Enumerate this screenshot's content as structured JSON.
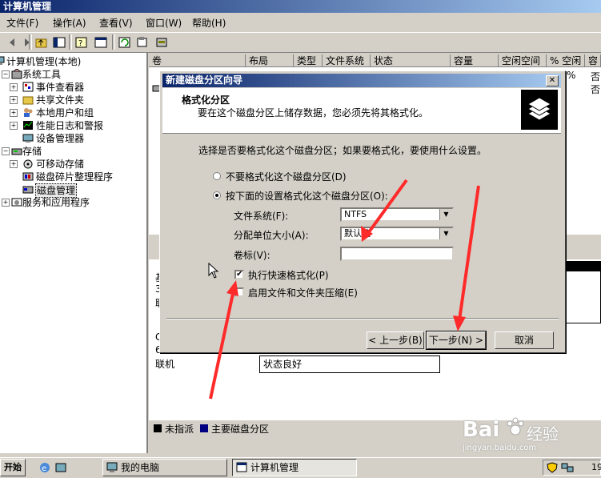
{
  "app": {
    "title": "计算机管理"
  },
  "menu": [
    "文件(F)",
    "操作(A)",
    "查看(V)",
    "窗口(W)",
    "帮助(H)"
  ],
  "tree": {
    "root": "计算机管理(本地)",
    "system_tools": "系统工具",
    "event_viewer": "事件查看器",
    "shared_folders": "共享文件夹",
    "local_users": "本地用户和组",
    "perf_logs": "性能日志和警报",
    "device_manager": "设备管理器",
    "storage": "存储",
    "removable": "可移动存储",
    "defrag": "磁盘碎片整理程序",
    "disk_mgmt": "磁盘管理",
    "services": "服务和应用程序"
  },
  "columns": [
    "卷",
    "布局",
    "类型",
    "文件系统",
    "状态",
    "容量",
    "空闲空间",
    "% 空闲",
    "容"
  ],
  "list_fragments": {
    "pct1": "%",
    "col1": "否",
    "col2": "否"
  },
  "disk": {
    "label_a": "基",
    "label_b": "30",
    "label_c": "联",
    "cd_a": "C",
    "cd_b": "65",
    "online": "联机",
    "status": "状态良好"
  },
  "legend": {
    "unallocated": "未指派",
    "primary": "主要磁盘分区"
  },
  "dialog": {
    "title": "新建磁盘分区向导",
    "header_title": "格式化分区",
    "header_sub": "要在这个磁盘分区上储存数据，您必须先将其格式化。",
    "prompt": "选择是否要格式化这个磁盘分区；如果要格式化，要使用什么设置。",
    "no_format": "不要格式化这个磁盘分区(D)",
    "do_format": "按下面的设置格式化这个磁盘分区(O):",
    "fs_label": "文件系统(F):",
    "fs_value": "NTFS",
    "alloc_label": "分配单位大小(A):",
    "alloc_value": "默认值",
    "vol_label": "卷标(V):",
    "vol_value": "",
    "quick_format": "执行快速格式化(P)",
    "compress": "启用文件和文件夹压缩(E)",
    "back": "< 上一步(B)",
    "next": "下一步(N) >",
    "cancel": "取消"
  },
  "taskbar": {
    "start": "开始",
    "task1": "我的电脑",
    "task2": "计算机管理",
    "clock": "19"
  },
  "watermark": {
    "brand": "Bai",
    "brand2": "经验",
    "url": "jingyan.baidu.com"
  },
  "colors": {
    "accent": "#0a246a",
    "arrow": "#ff2a2a"
  }
}
